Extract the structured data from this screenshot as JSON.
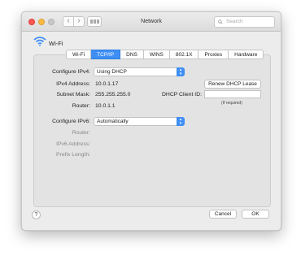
{
  "window": {
    "title": "Network"
  },
  "search": {
    "placeholder": "Search"
  },
  "nav": {
    "back_glyph": "‹",
    "forward_glyph": "›"
  },
  "interface": {
    "name": "Wi-Fi",
    "icon": "wifi-icon"
  },
  "tabs": [
    {
      "label": "Wi-Fi",
      "active": false
    },
    {
      "label": "TCP/IP",
      "active": true
    },
    {
      "label": "DNS",
      "active": false
    },
    {
      "label": "WINS",
      "active": false
    },
    {
      "label": "802.1X",
      "active": false
    },
    {
      "label": "Proxies",
      "active": false
    },
    {
      "label": "Hardware",
      "active": false
    }
  ],
  "ipv4": {
    "configure_label": "Configure IPv4:",
    "configure_value": "Using DHCP",
    "address_label": "IPv4 Address:",
    "address_value": "10.0.1.17",
    "subnet_label": "Subnet Mask:",
    "subnet_value": "255.255.255.0",
    "router_label": "Router:",
    "router_value": "10.0.1.1",
    "renew_button": "Renew DHCP Lease",
    "dhcp_client_label": "DHCP Client ID:",
    "dhcp_client_value": "",
    "dhcp_note": "(If required)"
  },
  "ipv6": {
    "configure_label": "Configure IPv6:",
    "configure_value": "Automatically",
    "router_label": "Router:",
    "address_label": "IPv6 Address:",
    "prefix_label": "Prefix Length:"
  },
  "footer": {
    "help": "?",
    "cancel": "Cancel",
    "ok": "OK"
  },
  "colors": {
    "accent": "#3e8ef4",
    "close": "#fc5753",
    "minimize": "#fdbc40"
  }
}
